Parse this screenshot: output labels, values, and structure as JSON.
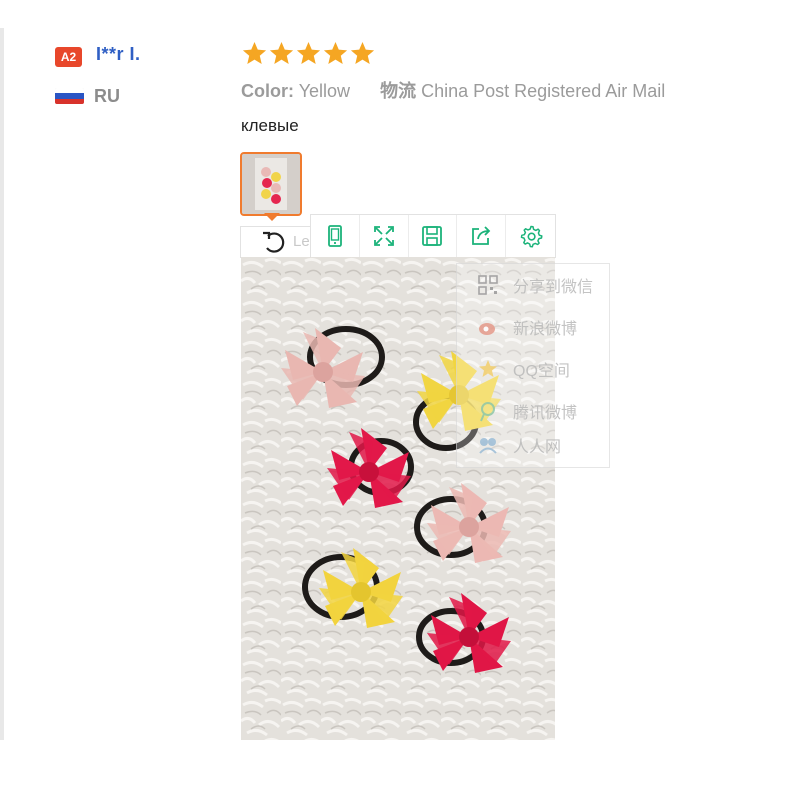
{
  "reviewer": {
    "level_badge": "A2",
    "name": "I**r I.",
    "country_code": "RU",
    "flag_colors": [
      "#ffffff",
      "#2a55c4",
      "#d8322b"
    ]
  },
  "review": {
    "rating_stars": 5,
    "star_color": "#f5a623",
    "color_label": "Color:",
    "color_value": "Yellow",
    "shipping_label": "物流",
    "shipping_value": "China Post Registered Air Mail",
    "feedback_text": "клевые"
  },
  "image_viewer": {
    "rotate_label": "Le",
    "toolbar_icons": [
      "phone-view-icon",
      "fullscreen-icon",
      "save-icon",
      "share-icon",
      "settings-icon"
    ],
    "accent_color": "#1bb37a",
    "photo_description_icon": "hair-bows-photo",
    "share_menu": [
      {
        "label": "分享到微信",
        "icon": "qr-code-icon"
      },
      {
        "label": "新浪微博",
        "icon": "weibo-icon"
      },
      {
        "label": "QQ空间",
        "icon": "qzone-icon"
      },
      {
        "label": "腾讯微博",
        "icon": "tencent-weibo-icon"
      },
      {
        "label": "人人网",
        "icon": "renren-icon"
      }
    ]
  }
}
